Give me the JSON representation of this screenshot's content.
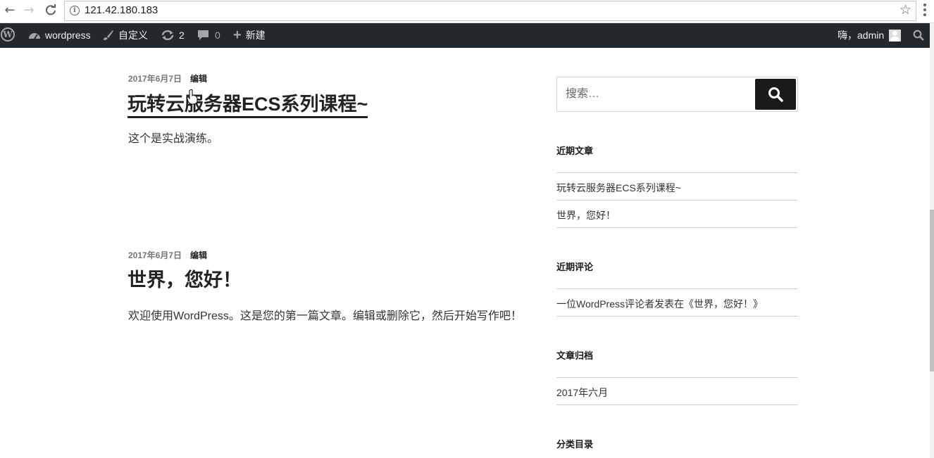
{
  "browser": {
    "url": "121.42.180.183",
    "back_icon": "←",
    "forward_icon": "→",
    "reload_icon": "C",
    "info_icon": "i",
    "star_icon": "☆"
  },
  "admin_bar": {
    "site_name": "wordpress",
    "customize_label": "自定义",
    "updates_count": "2",
    "comments_count": "0",
    "new_label": "新建",
    "greeting": "嗨，admin",
    "wp_logo_letter": "W",
    "plus_icon": "+"
  },
  "posts": [
    {
      "date": "2017年6月7日",
      "edit_label": "编辑",
      "title": "玩转云服务器ECS系列课程~",
      "excerpt": "这个是实战演练。"
    },
    {
      "date": "2017年6月7日",
      "edit_label": "编辑",
      "title": "世界，您好！",
      "excerpt": "欢迎使用WordPress。这是您的第一篇文章。编辑或删除它，然后开始写作吧！"
    }
  ],
  "sidebar": {
    "search_placeholder": "搜索…",
    "recent_posts": {
      "title": "近期文章",
      "items": [
        "玩转云服务器ECS系列课程~",
        "世界，您好！"
      ]
    },
    "recent_comments": {
      "title": "近期评论",
      "items": [
        "一位WordPress评论者发表在《世界，您好！》"
      ]
    },
    "archives": {
      "title": "文章归档",
      "items": [
        "2017年六月"
      ]
    },
    "categories": {
      "title": "分类目录"
    }
  },
  "colors": {
    "admin_bar_bg": "#23282d",
    "search_button_bg": "#1a1a1a"
  }
}
